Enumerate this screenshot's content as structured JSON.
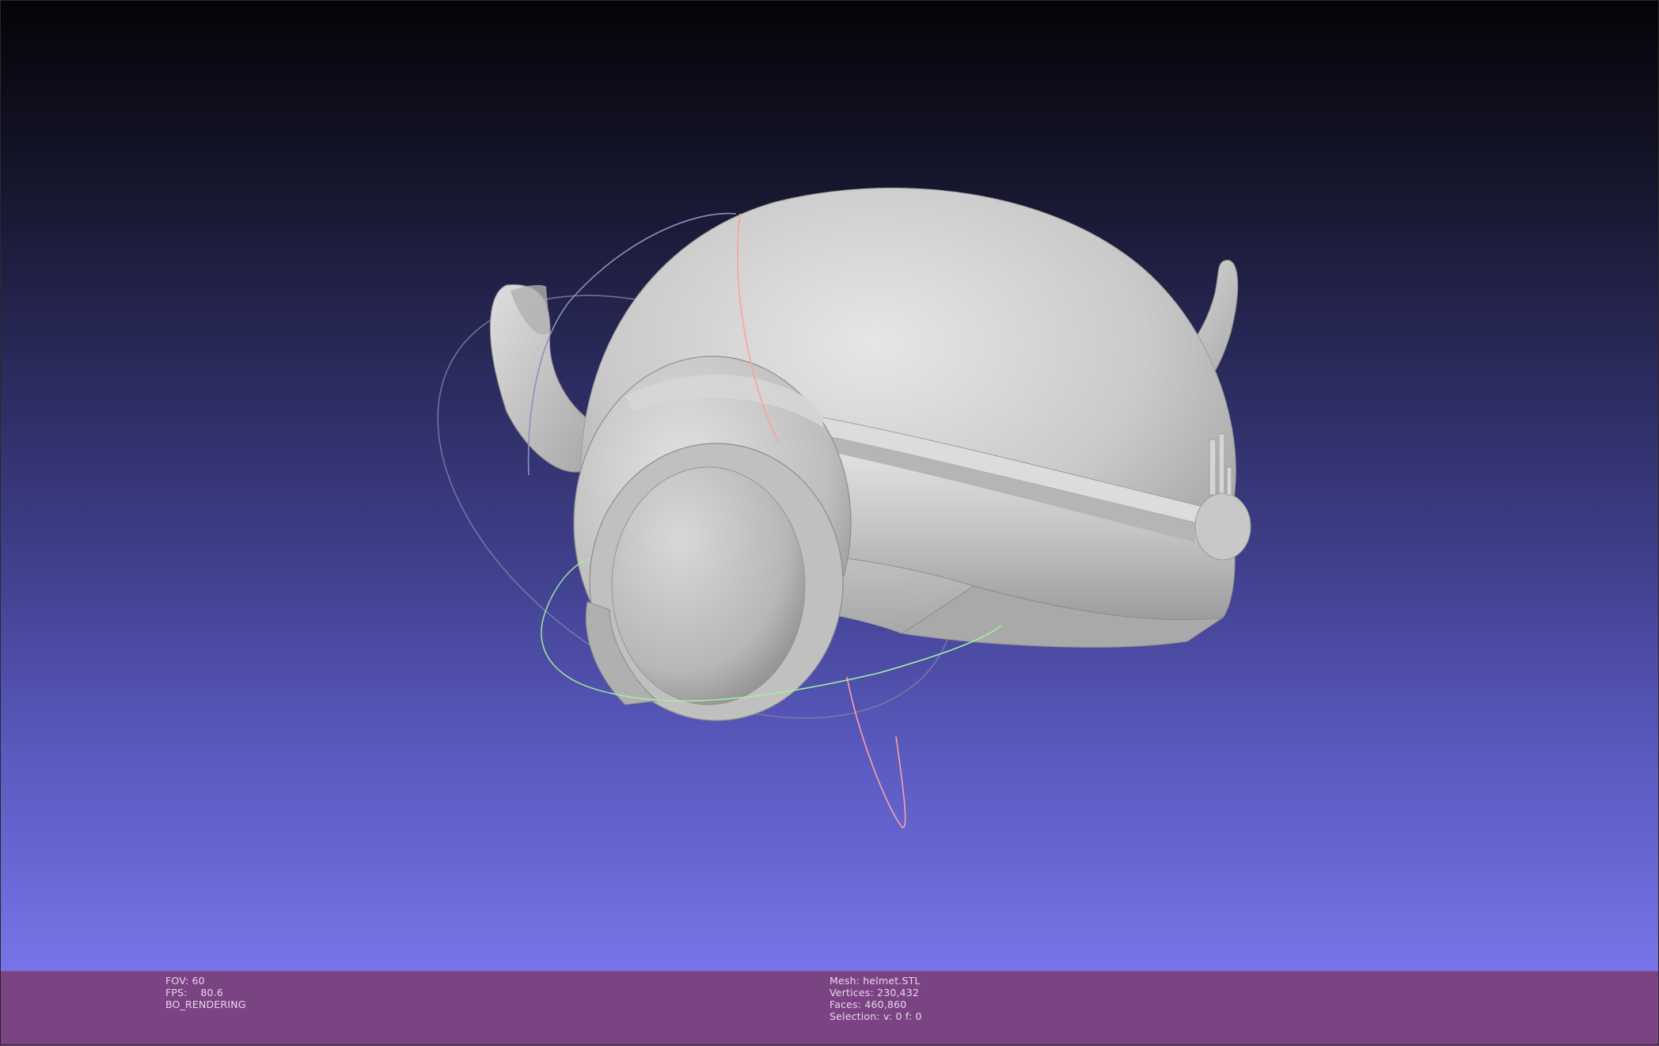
{
  "viewport": {
    "background_top_color": "#040408",
    "background_bottom_color": "#7575e8",
    "mesh_color": "#c9c9c9",
    "trackball_colors": {
      "x_ring": "#ff9a9a",
      "y_ring": "#9aff9a",
      "z_ring": "#9a9aff"
    }
  },
  "info_bar": {
    "background_color": "#7c4384",
    "left": {
      "fov": "FOV: 60",
      "fps": "FPS:    80.6",
      "render_mode": "BO_RENDERING"
    },
    "right": {
      "mesh": "Mesh: helmet.STL",
      "vertices": "Vertices: 230,432",
      "faces": "Faces: 460,860",
      "selection": "Selection: v: 0 f: 0"
    }
  }
}
